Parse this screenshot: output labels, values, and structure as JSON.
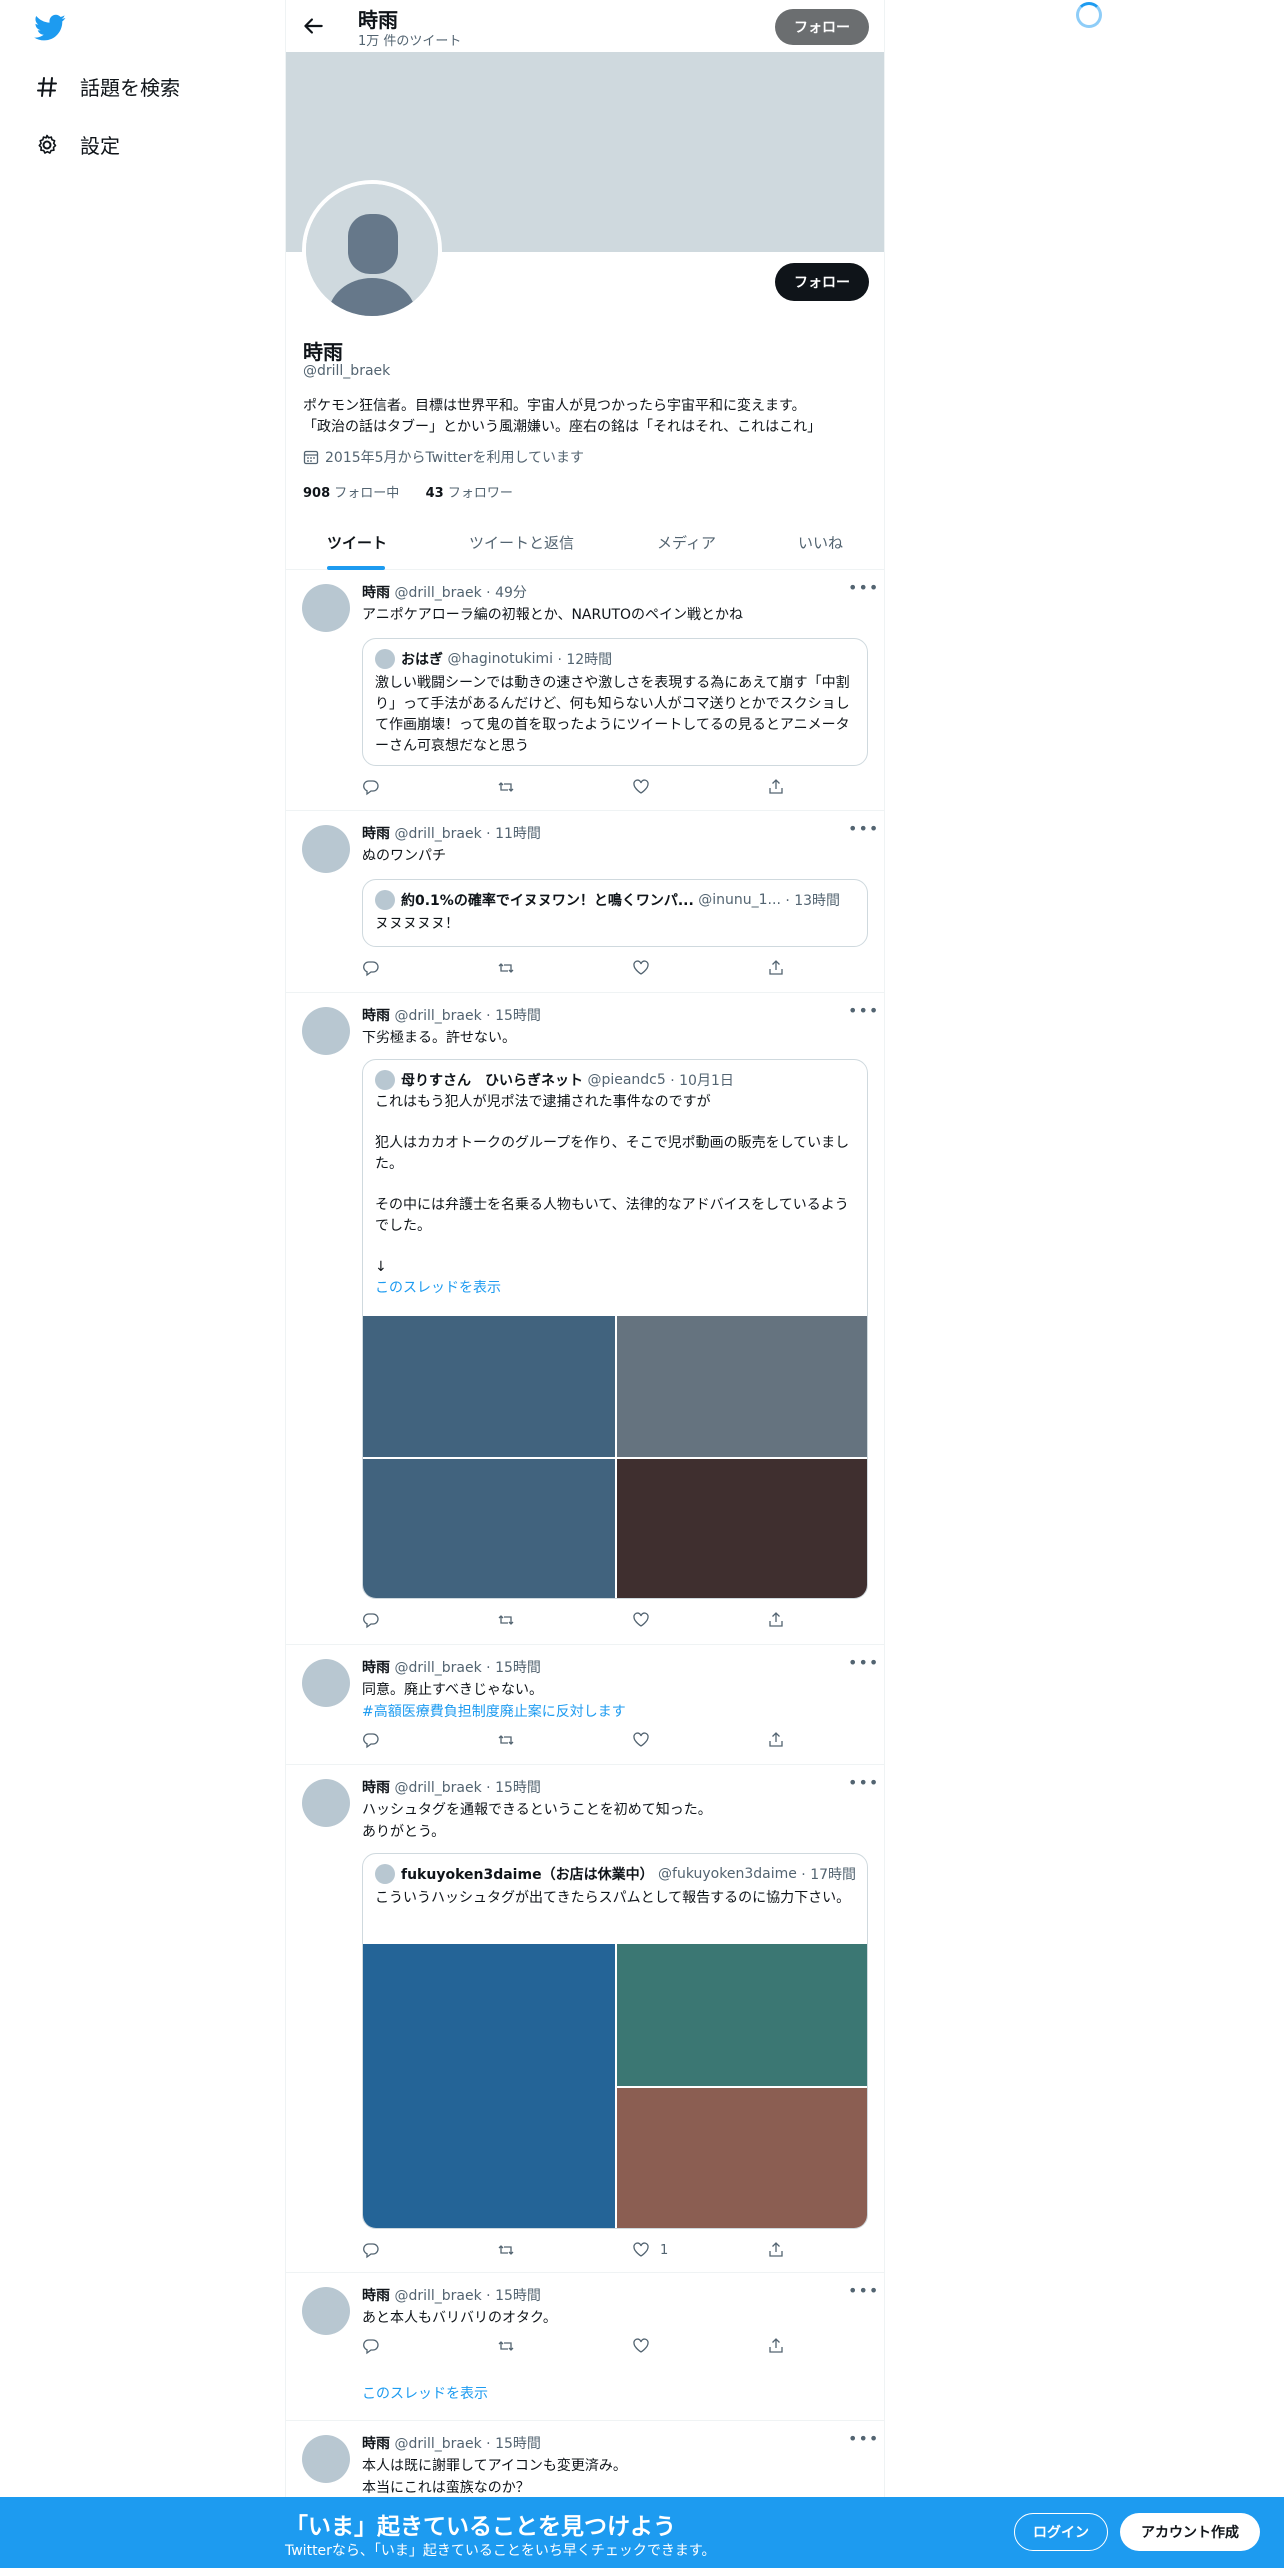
{
  "sidebar": {
    "items": [
      {
        "label": "話題を検索",
        "icon": "hashtag-icon"
      },
      {
        "label": "設定",
        "icon": "gear-icon"
      }
    ]
  },
  "topbar": {
    "name": "時雨",
    "tweet_count": "1万 件のツイート",
    "follow_label": "フォロー"
  },
  "profile": {
    "follow_label": "フォロー",
    "name": "時雨",
    "handle": "@drill_braek",
    "bio_line1": "ポケモン狂信者。目標は世界平和。宇宙人が見つかったら宇宙平和に変えます。",
    "bio_line2": "「政治の話はタブー」とかいう風潮嫌い。座右の銘は「それはそれ、これはこれ」",
    "joined": "2015年5月からTwitterを利用しています",
    "following_count": "908",
    "following_label": "フォロー中",
    "followers_count": "43",
    "followers_label": "フォロワー"
  },
  "tabs": [
    {
      "label": "ツイート",
      "active": true
    },
    {
      "label": "ツイートと返信",
      "active": false
    },
    {
      "label": "メディア",
      "active": false
    },
    {
      "label": "いいね",
      "active": false
    }
  ],
  "tweets": [
    {
      "name": "時雨",
      "handle": "@drill_braek",
      "time": "· 49分",
      "text": "アニポケアローラ編の初報とか、NARUTOのペイン戦とかね",
      "quote": {
        "name": "おはぎ",
        "handle": "@haginotukimi",
        "time": "· 12時間",
        "text": "激しい戦闘シーンでは動きの速さや激しさを表現する為にあえて崩す「中割り」って手法があるんだけど、何も知らない人がコマ送りとかでスクショして作画崩壊！って鬼の首を取ったようにツイートしてるの見るとアニメーターさん可哀想だなと思う"
      }
    },
    {
      "name": "時雨",
      "handle": "@drill_braek",
      "time": "· 11時間",
      "text": "ぬのワンパチ",
      "quote": {
        "name": "約0.1%の確率でイヌヌワン！と鳴くワンパ...",
        "handle": "@inunu_1...",
        "time": "· 13時間",
        "text": "ヌヌヌヌヌ！"
      }
    },
    {
      "name": "時雨",
      "handle": "@drill_braek",
      "time": "· 15時間",
      "text": "下劣極まる。許せない。",
      "quote": {
        "name": "母りすさん　ひいらぎネット",
        "handle": "@pieandc5",
        "time": "· 10月1日",
        "p1": "これはもう犯人が児ポ法で逮捕された事件なのですが",
        "p2": "犯人はカカオトークのグループを作り、そこで児ポ動画の販売をしていました。",
        "p3": "その中には弁護士を名乗る人物もいて、法律的なアドバイスをしているようでした。",
        "p4": "↓",
        "thread_link": "このスレッドを表示"
      },
      "media_colors": [
        "#41637e",
        "#65737f",
        "#41637e",
        "#3f2f2f"
      ]
    },
    {
      "name": "時雨",
      "handle": "@drill_braek",
      "time": "· 15時間",
      "text": "同意。廃止すべきじゃない。",
      "hashtag": "#高額医療費負担制度廃止案に反対します"
    },
    {
      "name": "時雨",
      "handle": "@drill_braek",
      "time": "· 15時間",
      "text1": "ハッシュタグを通報できるということを初めて知った。",
      "text2": "ありがとう。",
      "quote": {
        "name": "fukuyoken3daime（お店は休業中）",
        "handle": "@fukuyoken3daime",
        "time": "· 17時間",
        "text": "こういうハッシュタグが出てきたらスパムとして報告するのに協力下さい。"
      },
      "media_colors": [
        "#246497",
        "#3b7773",
        "#8b5e52"
      ],
      "like_count": "1"
    },
    {
      "name": "時雨",
      "handle": "@drill_braek",
      "time": "· 15時間",
      "text": "あと本人もバリバリのオタク。",
      "thread_link": "このスレッドを表示"
    },
    {
      "name": "時雨",
      "handle": "@drill_braek",
      "time": "· 15時間",
      "text1": "本人は既に謝罪してアイコンも変更済み。",
      "text2": "本当にこれは蛮族なのか？"
    }
  ],
  "bottom_bar": {
    "title": "「いま」起きていることを見つけよう",
    "subtitle": "Twitterなら、「いま」起きていることをいち早くチェックできます。",
    "login_label": "ログイン",
    "signup_label": "アカウント作成"
  },
  "colors": {
    "accent": "#1d9bf0",
    "banner": "#cfd9de",
    "text": "#0f1419",
    "muted": "#536471"
  }
}
